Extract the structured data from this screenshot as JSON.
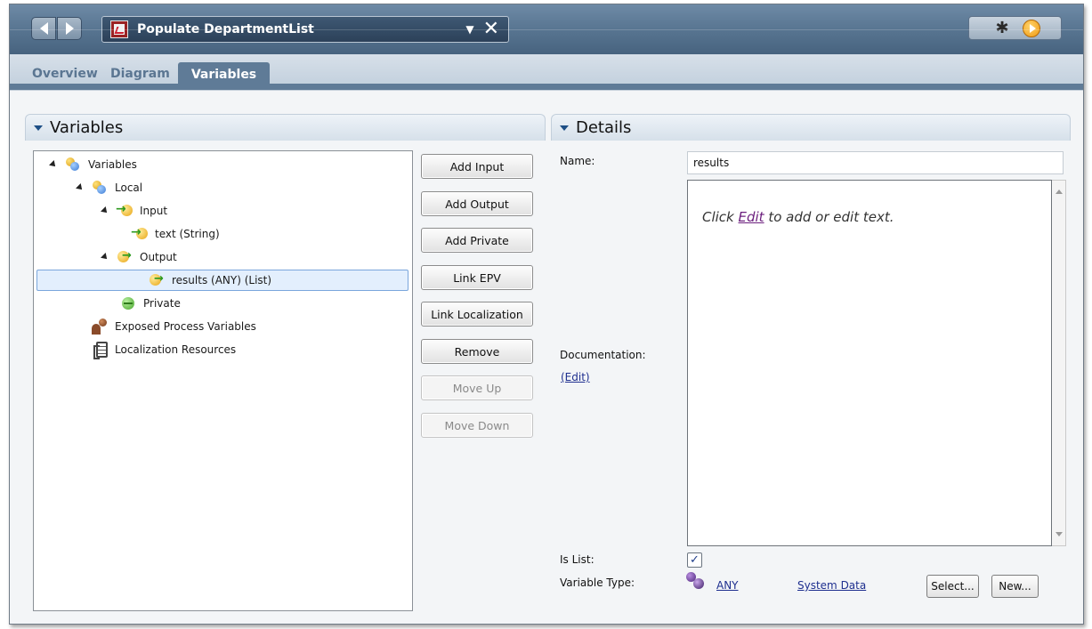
{
  "titlebar": {
    "document_title": "Populate DepartmentList",
    "icons": {
      "back": "back-arrow-icon",
      "forward": "forward-arrow-icon",
      "dropdown": "chevron-down-icon",
      "close": "close-icon",
      "debug": "bug-icon",
      "run": "play-icon"
    }
  },
  "tabs": [
    {
      "label": "Overview",
      "active": false
    },
    {
      "label": "Diagram",
      "active": false
    },
    {
      "label": "Variables",
      "active": true
    }
  ],
  "variables_panel": {
    "title": "Variables",
    "tree": [
      {
        "label": "Variables",
        "icon": "variables-icon",
        "level": 0,
        "expanded": true
      },
      {
        "label": "Local",
        "icon": "variables-icon",
        "level": 1,
        "expanded": true
      },
      {
        "label": "Input",
        "icon": "input-variable-icon",
        "level": 2,
        "expanded": true
      },
      {
        "label": "text (String)",
        "icon": "input-variable-icon",
        "level": 3
      },
      {
        "label": "Output",
        "icon": "output-variable-icon",
        "level": 2,
        "expanded": true
      },
      {
        "label": "results (ANY) (List)",
        "icon": "output-variable-icon",
        "level": 3,
        "selected": true
      },
      {
        "label": "Private",
        "icon": "private-variable-icon",
        "level": 2
      },
      {
        "label": "Exposed Process Variables",
        "icon": "epv-icon",
        "level": 1
      },
      {
        "label": "Localization Resources",
        "icon": "localization-icon",
        "level": 1
      }
    ],
    "buttons": [
      {
        "label": "Add Input",
        "enabled": true
      },
      {
        "label": "Add Output",
        "enabled": true
      },
      {
        "label": "Add Private",
        "enabled": true
      },
      {
        "label": "Link EPV",
        "enabled": true
      },
      {
        "label": "Link Localization",
        "enabled": true
      },
      {
        "label": "Remove",
        "enabled": true
      },
      {
        "label": "Move Up",
        "enabled": false
      },
      {
        "label": "Move Down",
        "enabled": false
      }
    ]
  },
  "details_panel": {
    "title": "Details",
    "name_label": "Name:",
    "name_value": "results",
    "doc_hint_prefix": "Click ",
    "doc_hint_link": "Edit",
    "doc_hint_suffix": " to add or edit text.",
    "documentation_label": "Documentation:",
    "documentation_edit_link": "(Edit)",
    "is_list_label": "Is List:",
    "is_list_checked": true,
    "is_list_mark": "✓",
    "variable_type_label": "Variable Type:",
    "variable_type_value": "ANY",
    "variable_type_source": "System Data",
    "select_label": "Select...",
    "new_label": "New..."
  }
}
